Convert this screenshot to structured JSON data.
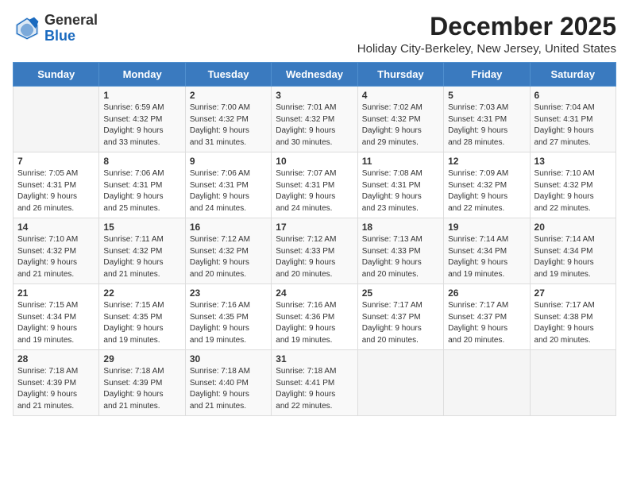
{
  "header": {
    "logo_general": "General",
    "logo_blue": "Blue",
    "month_title": "December 2025",
    "location": "Holiday City-Berkeley, New Jersey, United States"
  },
  "weekdays": [
    "Sunday",
    "Monday",
    "Tuesday",
    "Wednesday",
    "Thursday",
    "Friday",
    "Saturday"
  ],
  "weeks": [
    [
      {
        "day": "",
        "info": ""
      },
      {
        "day": "1",
        "info": "Sunrise: 6:59 AM\nSunset: 4:32 PM\nDaylight: 9 hours\nand 33 minutes."
      },
      {
        "day": "2",
        "info": "Sunrise: 7:00 AM\nSunset: 4:32 PM\nDaylight: 9 hours\nand 31 minutes."
      },
      {
        "day": "3",
        "info": "Sunrise: 7:01 AM\nSunset: 4:32 PM\nDaylight: 9 hours\nand 30 minutes."
      },
      {
        "day": "4",
        "info": "Sunrise: 7:02 AM\nSunset: 4:32 PM\nDaylight: 9 hours\nand 29 minutes."
      },
      {
        "day": "5",
        "info": "Sunrise: 7:03 AM\nSunset: 4:31 PM\nDaylight: 9 hours\nand 28 minutes."
      },
      {
        "day": "6",
        "info": "Sunrise: 7:04 AM\nSunset: 4:31 PM\nDaylight: 9 hours\nand 27 minutes."
      }
    ],
    [
      {
        "day": "7",
        "info": "Sunrise: 7:05 AM\nSunset: 4:31 PM\nDaylight: 9 hours\nand 26 minutes."
      },
      {
        "day": "8",
        "info": "Sunrise: 7:06 AM\nSunset: 4:31 PM\nDaylight: 9 hours\nand 25 minutes."
      },
      {
        "day": "9",
        "info": "Sunrise: 7:06 AM\nSunset: 4:31 PM\nDaylight: 9 hours\nand 24 minutes."
      },
      {
        "day": "10",
        "info": "Sunrise: 7:07 AM\nSunset: 4:31 PM\nDaylight: 9 hours\nand 24 minutes."
      },
      {
        "day": "11",
        "info": "Sunrise: 7:08 AM\nSunset: 4:31 PM\nDaylight: 9 hours\nand 23 minutes."
      },
      {
        "day": "12",
        "info": "Sunrise: 7:09 AM\nSunset: 4:32 PM\nDaylight: 9 hours\nand 22 minutes."
      },
      {
        "day": "13",
        "info": "Sunrise: 7:10 AM\nSunset: 4:32 PM\nDaylight: 9 hours\nand 22 minutes."
      }
    ],
    [
      {
        "day": "14",
        "info": "Sunrise: 7:10 AM\nSunset: 4:32 PM\nDaylight: 9 hours\nand 21 minutes."
      },
      {
        "day": "15",
        "info": "Sunrise: 7:11 AM\nSunset: 4:32 PM\nDaylight: 9 hours\nand 21 minutes."
      },
      {
        "day": "16",
        "info": "Sunrise: 7:12 AM\nSunset: 4:32 PM\nDaylight: 9 hours\nand 20 minutes."
      },
      {
        "day": "17",
        "info": "Sunrise: 7:12 AM\nSunset: 4:33 PM\nDaylight: 9 hours\nand 20 minutes."
      },
      {
        "day": "18",
        "info": "Sunrise: 7:13 AM\nSunset: 4:33 PM\nDaylight: 9 hours\nand 20 minutes."
      },
      {
        "day": "19",
        "info": "Sunrise: 7:14 AM\nSunset: 4:34 PM\nDaylight: 9 hours\nand 19 minutes."
      },
      {
        "day": "20",
        "info": "Sunrise: 7:14 AM\nSunset: 4:34 PM\nDaylight: 9 hours\nand 19 minutes."
      }
    ],
    [
      {
        "day": "21",
        "info": "Sunrise: 7:15 AM\nSunset: 4:34 PM\nDaylight: 9 hours\nand 19 minutes."
      },
      {
        "day": "22",
        "info": "Sunrise: 7:15 AM\nSunset: 4:35 PM\nDaylight: 9 hours\nand 19 minutes."
      },
      {
        "day": "23",
        "info": "Sunrise: 7:16 AM\nSunset: 4:35 PM\nDaylight: 9 hours\nand 19 minutes."
      },
      {
        "day": "24",
        "info": "Sunrise: 7:16 AM\nSunset: 4:36 PM\nDaylight: 9 hours\nand 19 minutes."
      },
      {
        "day": "25",
        "info": "Sunrise: 7:17 AM\nSunset: 4:37 PM\nDaylight: 9 hours\nand 20 minutes."
      },
      {
        "day": "26",
        "info": "Sunrise: 7:17 AM\nSunset: 4:37 PM\nDaylight: 9 hours\nand 20 minutes."
      },
      {
        "day": "27",
        "info": "Sunrise: 7:17 AM\nSunset: 4:38 PM\nDaylight: 9 hours\nand 20 minutes."
      }
    ],
    [
      {
        "day": "28",
        "info": "Sunrise: 7:18 AM\nSunset: 4:39 PM\nDaylight: 9 hours\nand 21 minutes."
      },
      {
        "day": "29",
        "info": "Sunrise: 7:18 AM\nSunset: 4:39 PM\nDaylight: 9 hours\nand 21 minutes."
      },
      {
        "day": "30",
        "info": "Sunrise: 7:18 AM\nSunset: 4:40 PM\nDaylight: 9 hours\nand 21 minutes."
      },
      {
        "day": "31",
        "info": "Sunrise: 7:18 AM\nSunset: 4:41 PM\nDaylight: 9 hours\nand 22 minutes."
      },
      {
        "day": "",
        "info": ""
      },
      {
        "day": "",
        "info": ""
      },
      {
        "day": "",
        "info": ""
      }
    ]
  ]
}
